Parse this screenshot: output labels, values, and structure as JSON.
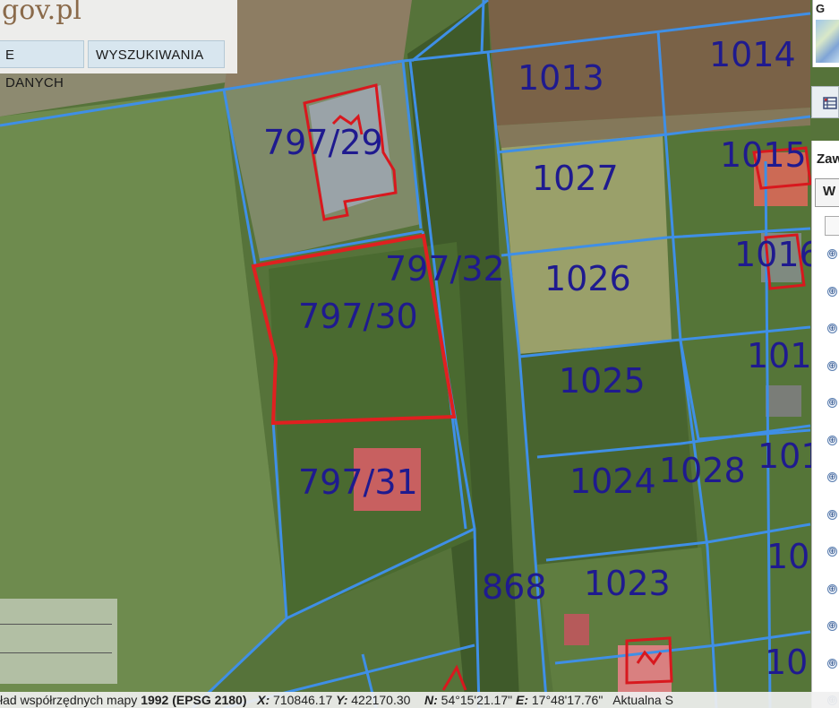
{
  "header": {
    "logo_text": "gov.pl",
    "buttons": [
      "E DANYCH",
      "WYSZUKIWANIA"
    ]
  },
  "map": {
    "parcels": [
      "1013",
      "1014",
      "797/29",
      "1015",
      "1027",
      "1016",
      "797/32",
      "1026",
      "797/30",
      "101",
      "1025",
      "797/31",
      "1024",
      "1028",
      "101",
      "868",
      "1023",
      "10",
      "10"
    ],
    "colors": {
      "parcel_border": "#3f8fe6",
      "selected_parcel": "#e02020",
      "building_outline": "#d8181e",
      "label_text": "#1f1a8f"
    }
  },
  "overview_map": {
    "label": "G"
  },
  "tools": {
    "grid_icon": "grid-icon"
  },
  "side_panel": {
    "title": "Zaw",
    "tab_label": "W",
    "expander_symbol": "⊕",
    "expander_count": 13
  },
  "status_bar": {
    "prefix": "ład współrzędnych mapy ",
    "crs": "1992 (EPSG 2180)",
    "x_label": "X:",
    "x_value": "710846.17",
    "y_label": "Y:",
    "y_value": "422170.30",
    "n_label": "N:",
    "n_value": "54°15'21.17\"",
    "e_label": "E:",
    "e_value": "17°48'17.76\"",
    "suffix": "Aktualna S"
  }
}
